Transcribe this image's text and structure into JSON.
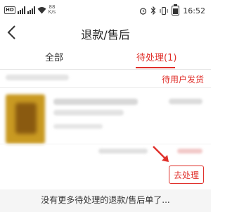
{
  "status_bar": {
    "network_badge": "HD",
    "speed_value": "88",
    "speed_unit": "K/s",
    "time": "16:52"
  },
  "nav": {
    "title": "退款/售后"
  },
  "tabs": [
    {
      "label": "全部"
    },
    {
      "label": "待处理(1)"
    }
  ],
  "order": {
    "status": "待用户发货",
    "action_button": "去处理"
  },
  "footer": {
    "message": "没有更多待处理的退款/售后单了..."
  },
  "colors": {
    "accent": "#e0302b"
  }
}
